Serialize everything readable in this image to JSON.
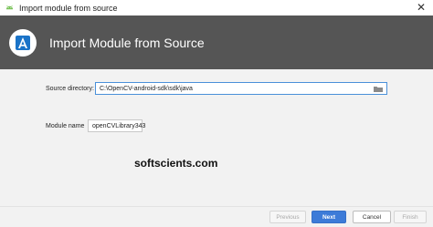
{
  "window": {
    "title": "Import module from source",
    "close_glyph": "✕"
  },
  "header": {
    "title": "Import Module from Source",
    "logo_icon": "android-studio-icon"
  },
  "form": {
    "source_directory": {
      "label": "Source directory:",
      "value": "C:\\OpenCV-android-sdk\\sdk\\java"
    },
    "module_name": {
      "label": "Module name",
      "value": "openCVLibrary343"
    }
  },
  "watermark": "softscients.com",
  "buttons": {
    "previous": "Previous",
    "next": "Next",
    "cancel": "Cancel",
    "finish": "Finish"
  },
  "colors": {
    "header_bg": "#555555",
    "primary": "#3d7bd8",
    "focus_border": "#4a90d9"
  }
}
